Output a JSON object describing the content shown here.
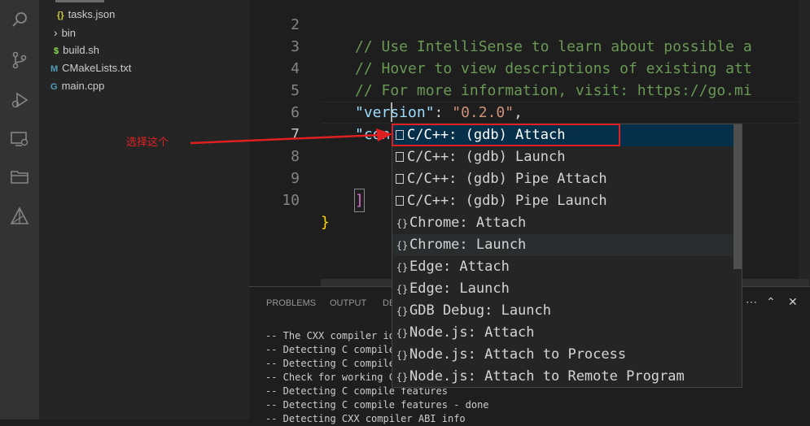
{
  "sidebar": {
    "items": [
      {
        "label": "tasks.json",
        "icon": "{}"
      },
      {
        "label": "bin",
        "icon": "›"
      },
      {
        "label": "build.sh",
        "icon": "$"
      },
      {
        "label": "CMakeLists.txt",
        "icon": "M"
      },
      {
        "label": "main.cpp",
        "icon": "G"
      }
    ]
  },
  "editor": {
    "lines": [
      {
        "num": "2",
        "text": "// Use IntelliSense to learn about possible a"
      },
      {
        "num": "3",
        "text": "// Hover to view descriptions of existing att"
      },
      {
        "num": "4",
        "text": "// For more information, visit: https://go.mi"
      },
      {
        "num": "5",
        "key": "\"version\"",
        "colon": ": ",
        "val": "\"0.2.0\"",
        "tail": ","
      },
      {
        "num": "6",
        "key": "\"configurations\"",
        "colon": ": ",
        "bracket": "["
      },
      {
        "num": "7",
        "text": ""
      },
      {
        "num": "8",
        "text": ""
      },
      {
        "num": "9",
        "bracket": "]"
      },
      {
        "num": "10",
        "brace": "}"
      }
    ]
  },
  "suggestions": [
    {
      "label": "C/C++: (gdb) Attach",
      "icon": "box"
    },
    {
      "label": "C/C++: (gdb) Launch",
      "icon": "box"
    },
    {
      "label": "C/C++: (gdb) Pipe Attach",
      "icon": "box"
    },
    {
      "label": "C/C++: (gdb) Pipe Launch",
      "icon": "box"
    },
    {
      "label": "Chrome: Attach",
      "icon": "{}"
    },
    {
      "label": "Chrome: Launch",
      "icon": "{}"
    },
    {
      "label": "Edge: Attach",
      "icon": "{}"
    },
    {
      "label": "Edge: Launch",
      "icon": "{}"
    },
    {
      "label": "GDB Debug: Launch",
      "icon": "{}"
    },
    {
      "label": "Node.js: Attach",
      "icon": "{}"
    },
    {
      "label": "Node.js: Attach to Process",
      "icon": "{}"
    },
    {
      "label": "Node.js: Attach to Remote Program",
      "icon": "{}"
    }
  ],
  "panel": {
    "tabs": [
      "PROBLEMS",
      "OUTPUT",
      "DE"
    ],
    "terminal": [
      "-- The CXX compiler id",
      "-- Detecting C compile",
      "-- Detecting C compile",
      "-- Check for working C",
      "-- Detecting C compile features",
      "-- Detecting C compile features - done",
      "-- Detecting CXX compiler ABI info"
    ]
  },
  "annotation": {
    "text": "选择这个"
  },
  "colors": {
    "highlight": "#e02020",
    "selected_bg": "#062f4a",
    "accent": "#007acc"
  }
}
